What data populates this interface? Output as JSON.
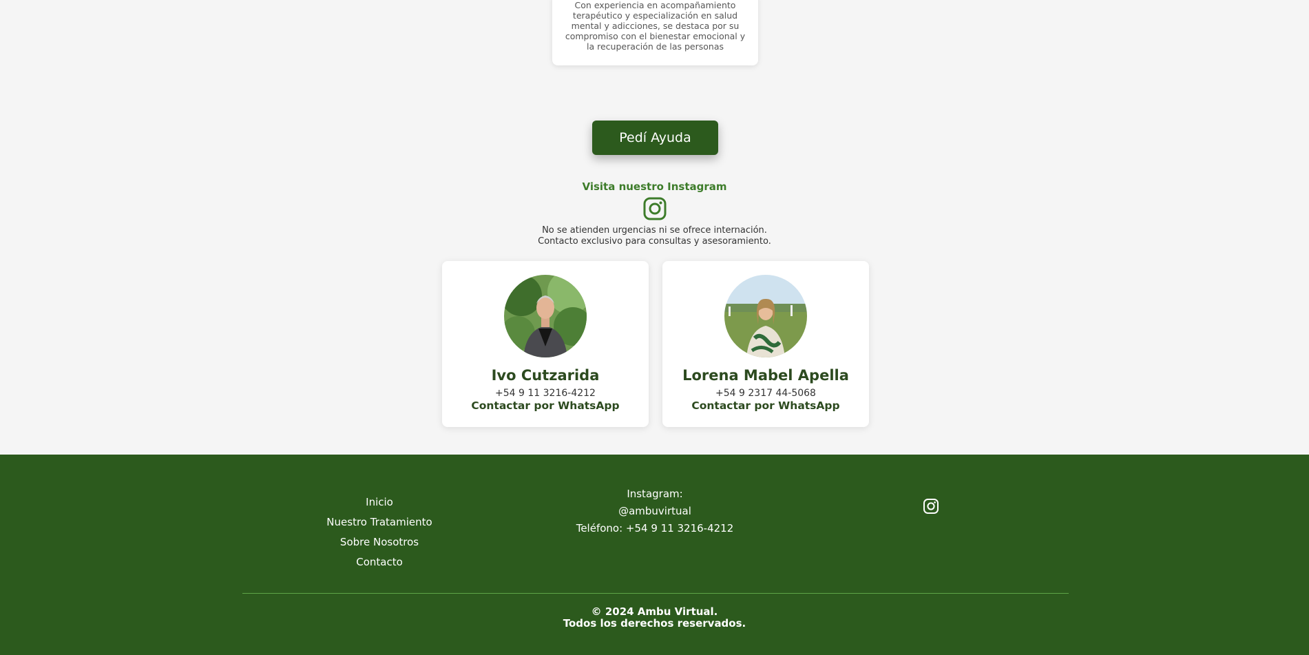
{
  "top_card": {
    "lines": [
      "Con experiencia en acompañamiento",
      "terapéutico y especialización en salud",
      "mental y adicciones, se destaca por su",
      "compromiso con el bienestar emocional y",
      "la recuperación de las personas"
    ]
  },
  "cta": {
    "help_label": "Pedí Ayuda"
  },
  "instagram_section": {
    "visit_label": "Visita nuestro Instagram",
    "icon": "instagram-icon"
  },
  "notice": {
    "line1": "No se atienden urgencias ni se ofrece internación.",
    "line2": "Contacto exclusivo para consultas y asesoramiento."
  },
  "team": [
    {
      "name": "Ivo Cutzarida",
      "phone": "+54 9 11 3216-4212",
      "whatsapp_label": "Contactar por WhatsApp"
    },
    {
      "name": "Lorena Mabel Apella",
      "phone": "+54 9 2317 44-5068",
      "whatsapp_label": "Contactar por WhatsApp"
    }
  ],
  "footer": {
    "nav": [
      "Inicio",
      "Nuestro Tratamiento",
      "Sobre Nosotros",
      "Contacto"
    ],
    "instagram_label": "Instagram:",
    "instagram_handle": "@ambuvirtual",
    "phone_line": "Teléfono: +54 9 11 3216-4212",
    "copyright_line1": "© 2024 Ambu Virtual.",
    "copyright_line2": "Todos los derechos reservados."
  },
  "colors": {
    "brand_green": "#2c5a1d",
    "accent_green": "#3d7c2a",
    "background": "#f5f5f5"
  }
}
